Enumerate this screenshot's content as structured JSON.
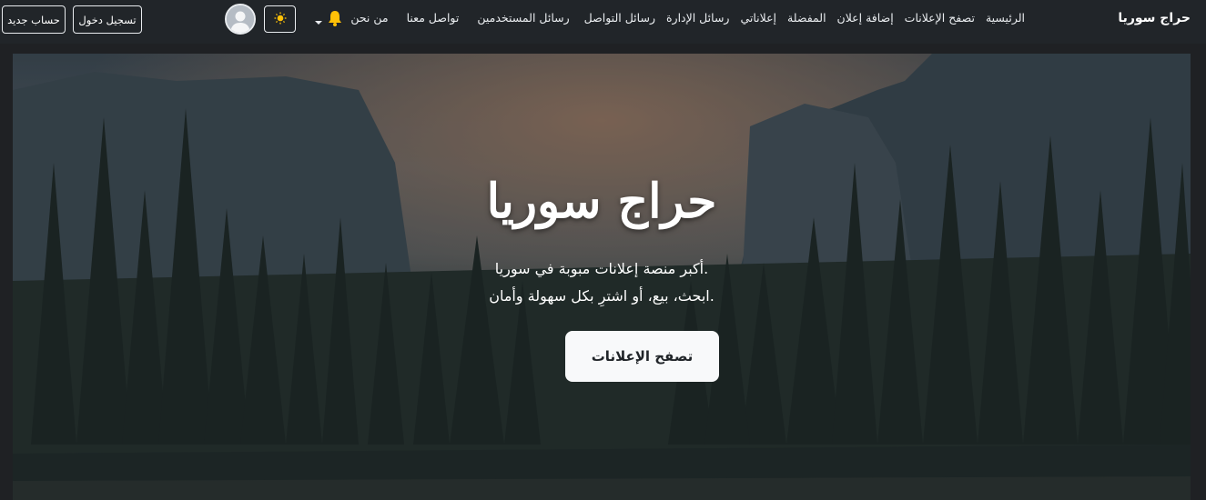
{
  "navbar": {
    "brand": "حراج سوريا",
    "links": [
      "الرئيسية",
      "تصفح الإعلانات",
      "إضافة إعلان",
      "المفضلة",
      "إعلاناتي",
      "رسائل الإدارة",
      "رسائل التواصل",
      "رسائل المستخدمين",
      "تواصل معنا",
      "من نحن"
    ],
    "login_label": "تسجيل دخول",
    "register_label": "حساب جديد"
  },
  "hero": {
    "title": "حراج سوريا",
    "subtitle_line1": "أكبر منصة إعلانات مبوبة في سوريا.",
    "subtitle_line2": "ابحث، بيع، أو اشترِ بكل سهولة وأمان.",
    "cta_label": "تصفح الإعلانات"
  },
  "colors": {
    "navbar_bg": "#212529",
    "cta_bg": "#f8f9fa",
    "bell": "#ffc107"
  },
  "icons": {
    "notifications": "bell-icon",
    "theme_toggle": "sun-icon",
    "profile": "avatar"
  }
}
